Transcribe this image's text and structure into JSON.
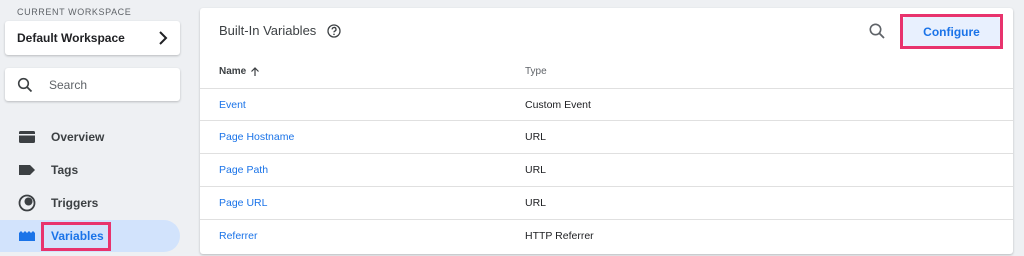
{
  "sidebar": {
    "workspace_label": "CURRENT WORKSPACE",
    "workspace_name": "Default Workspace",
    "search_placeholder": "Search",
    "items": [
      {
        "label": "Overview",
        "icon": "folder-icon"
      },
      {
        "label": "Tags",
        "icon": "tag-icon"
      },
      {
        "label": "Triggers",
        "icon": "trigger-icon"
      },
      {
        "label": "Variables",
        "icon": "variables-icon",
        "active": true
      }
    ]
  },
  "panel": {
    "title": "Built-In Variables",
    "configure_label": "Configure",
    "columns": {
      "name": "Name",
      "type": "Type"
    },
    "rows": [
      {
        "name": "Event",
        "type": "Custom Event"
      },
      {
        "name": "Page Hostname",
        "type": "URL"
      },
      {
        "name": "Page Path",
        "type": "URL"
      },
      {
        "name": "Page URL",
        "type": "URL"
      },
      {
        "name": "Referrer",
        "type": "HTTP Referrer"
      }
    ]
  },
  "colors": {
    "accent": "#1a73e8",
    "active_bg": "#d2e3fc",
    "highlight": "#e8336d",
    "configure_bg": "#e8f0fe"
  }
}
